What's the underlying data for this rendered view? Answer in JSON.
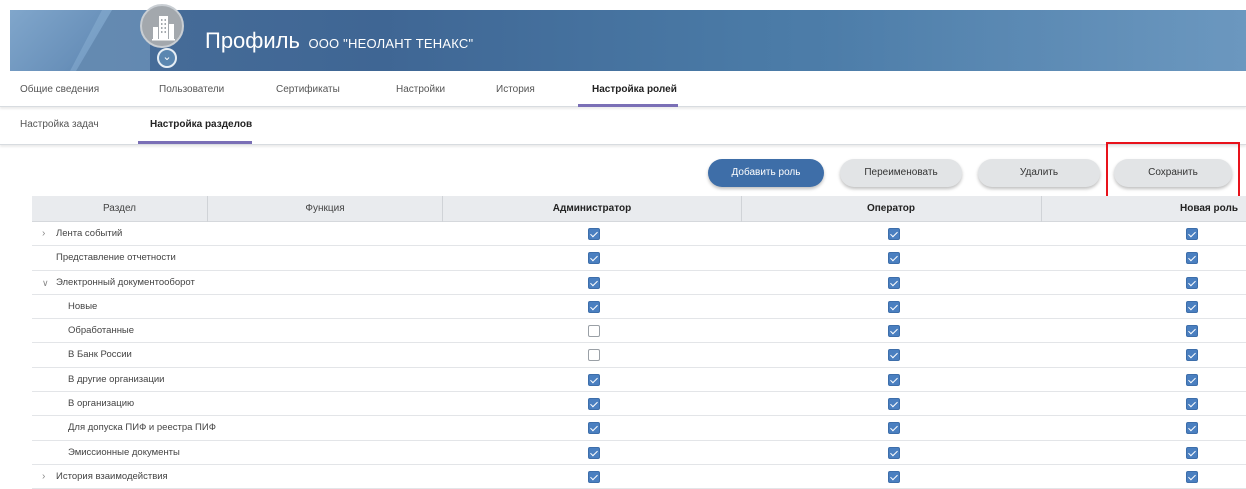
{
  "header": {
    "title": "Профиль",
    "org": "ООО \"НЕОЛАНТ ТЕНАКС\"",
    "logo_icon": "building-icon",
    "badge_icon": "chevron-down-icon"
  },
  "tabs": [
    {
      "label": "Общие сведения"
    },
    {
      "label": "Пользователи"
    },
    {
      "label": "Сертификаты"
    },
    {
      "label": "Настройки"
    },
    {
      "label": "История"
    },
    {
      "label": "Настройка ролей"
    }
  ],
  "active_tab": "Настройка ролей",
  "subtabs": [
    {
      "label": "Настройка задач"
    },
    {
      "label": "Настройка разделов"
    }
  ],
  "active_subtab": "Настройка разделов",
  "buttons": {
    "add_role": "Добавить роль",
    "rename": "Переименовать",
    "delete": "Удалить",
    "save": "Сохранить"
  },
  "colors": {
    "accent": "#3e6ea8",
    "highlight": "#e8121b",
    "tab_underline": "#7a6fb6",
    "checkbox": "#4a7fc0"
  },
  "table": {
    "columns": [
      "Раздел",
      "Функция",
      "Администратор",
      "Оператор",
      "Новая роль"
    ],
    "rows": [
      {
        "label": "Лента событий",
        "expander": "collapsed",
        "admin": true,
        "operator": true,
        "new_role": true
      },
      {
        "label": "Представление отчетности",
        "expander": "none",
        "admin": true,
        "operator": true,
        "new_role": true
      },
      {
        "label": "Электронный документооборот",
        "expander": "expanded",
        "admin": true,
        "operator": true,
        "new_role": true
      },
      {
        "label": "Новые",
        "expander": "child",
        "admin": true,
        "operator": true,
        "new_role": true
      },
      {
        "label": "Обработанные",
        "expander": "child",
        "admin": false,
        "operator": true,
        "new_role": true
      },
      {
        "label": "В Банк России",
        "expander": "child",
        "admin": false,
        "operator": true,
        "new_role": true
      },
      {
        "label": "В другие организации",
        "expander": "child",
        "admin": true,
        "operator": true,
        "new_role": true
      },
      {
        "label": "В организацию",
        "expander": "child",
        "admin": true,
        "operator": true,
        "new_role": true
      },
      {
        "label": "Для допуска ПИФ и реестра ПИФ",
        "expander": "child",
        "admin": true,
        "operator": true,
        "new_role": true
      },
      {
        "label": "Эмиссионные документы",
        "expander": "child",
        "admin": true,
        "operator": true,
        "new_role": true
      },
      {
        "label": "История взаимодействия",
        "expander": "collapsed",
        "admin": true,
        "operator": true,
        "new_role": true
      }
    ]
  }
}
